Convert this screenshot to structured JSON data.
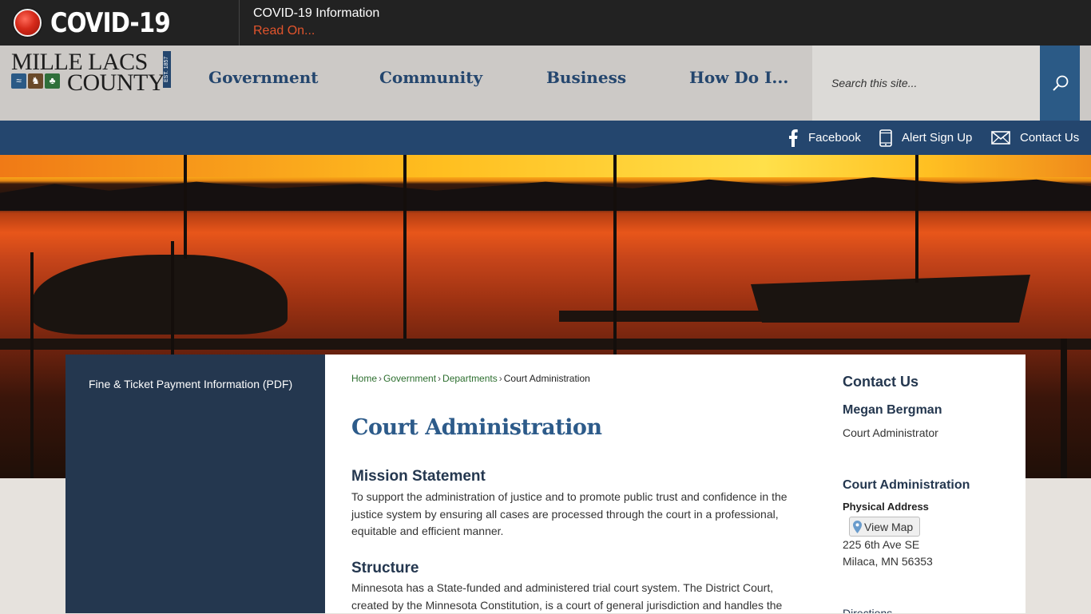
{
  "covid": {
    "title": "COVID-19",
    "info": "COVID-19 Information",
    "read_on": "Read On..."
  },
  "header": {
    "logo_line1": "MILLE LACS",
    "logo_line2": "COUNTY",
    "logo_est": "EST. 1857",
    "nav": [
      "Government",
      "Community",
      "Business",
      "How Do I..."
    ],
    "search_placeholder": "Search this site..."
  },
  "utility": {
    "facebook": "Facebook",
    "alert": "Alert Sign Up",
    "contact": "Contact Us"
  },
  "sidebar": {
    "link": "Fine & Ticket Payment Information (PDF)"
  },
  "breadcrumb": {
    "home": "Home",
    "government": "Government",
    "departments": "Departments",
    "current": "Court Administration",
    "separator": "›"
  },
  "main": {
    "title": "Court Administration",
    "mission_heading": "Mission Statement",
    "mission_text": "To support the administration of justice and to promote public trust and confidence in the justice system by ensuring all cases are processed through the court in a professional, equitable and efficient manner.",
    "structure_heading": "Structure",
    "structure_text": "Minnesota has a State-funded and administered trial court system. The District Court, created by the Minnesota Constitution, is a court of general jurisdiction and handles the"
  },
  "contact": {
    "title": "Contact Us",
    "name": "Megan Bergman",
    "role": "Court Administrator",
    "dept": "Court Administration",
    "physical_label": "Physical Address",
    "view_map": "View Map",
    "address1": "225 6th Ave SE",
    "address2": "Milaca, MN 56353",
    "cut_text": "Directions"
  },
  "colors": {
    "navy": "#24466e",
    "panel": "#24374f",
    "accent_orange": "#e2542c",
    "link_green": "#2c6e2e"
  }
}
